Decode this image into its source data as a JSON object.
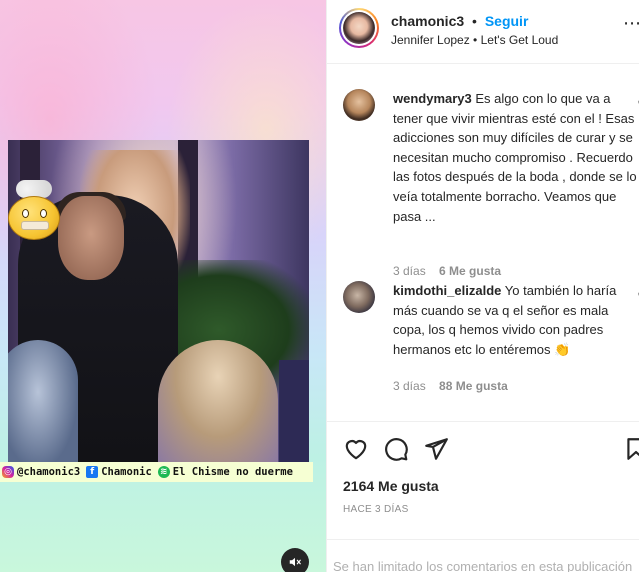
{
  "post": {
    "username": "chamonic3",
    "separator": "•",
    "follow_label": "Seguir",
    "audio": "Jennifer Lopez • Let's Get Loud",
    "more_icon": "ellipsis-icon"
  },
  "media": {
    "credits": {
      "instagram": "@chamonic3",
      "facebook": "Chamonic",
      "spotify": "El Chisme no duerme"
    },
    "mute_icon": "muted-speaker-icon"
  },
  "comments": [
    {
      "user": "wendymary3",
      "text": "Es algo con lo que va a tener que vivir mientras esté con el ! Esas adicciones son muy difíciles de curar y se necesitan mucho compromiso . Recuerdo las fotos después de la boda , donde se lo veía totalmente borracho. Veamos que pasa ...",
      "time": "3 días",
      "likes": "6 Me gusta"
    },
    {
      "user": "kimdothi_elizalde",
      "text": "Yo también lo haría más cuando se va q el señor es mala copa, los q hemos vivido con padres hermanos etc lo entéremos 👏",
      "time": "3 días",
      "likes": "88 Me gusta"
    }
  ],
  "actions": {
    "likes_total": "2164 Me gusta",
    "date": "HACE 3 DÍAS"
  },
  "footer": {
    "limited_text": "Se han limitado los comentarios en esta publicación"
  },
  "colors": {
    "accent_blue": "#0095f6",
    "text_primary": "#262626",
    "text_secondary": "#8e8e8e",
    "divider": "#efefef"
  }
}
